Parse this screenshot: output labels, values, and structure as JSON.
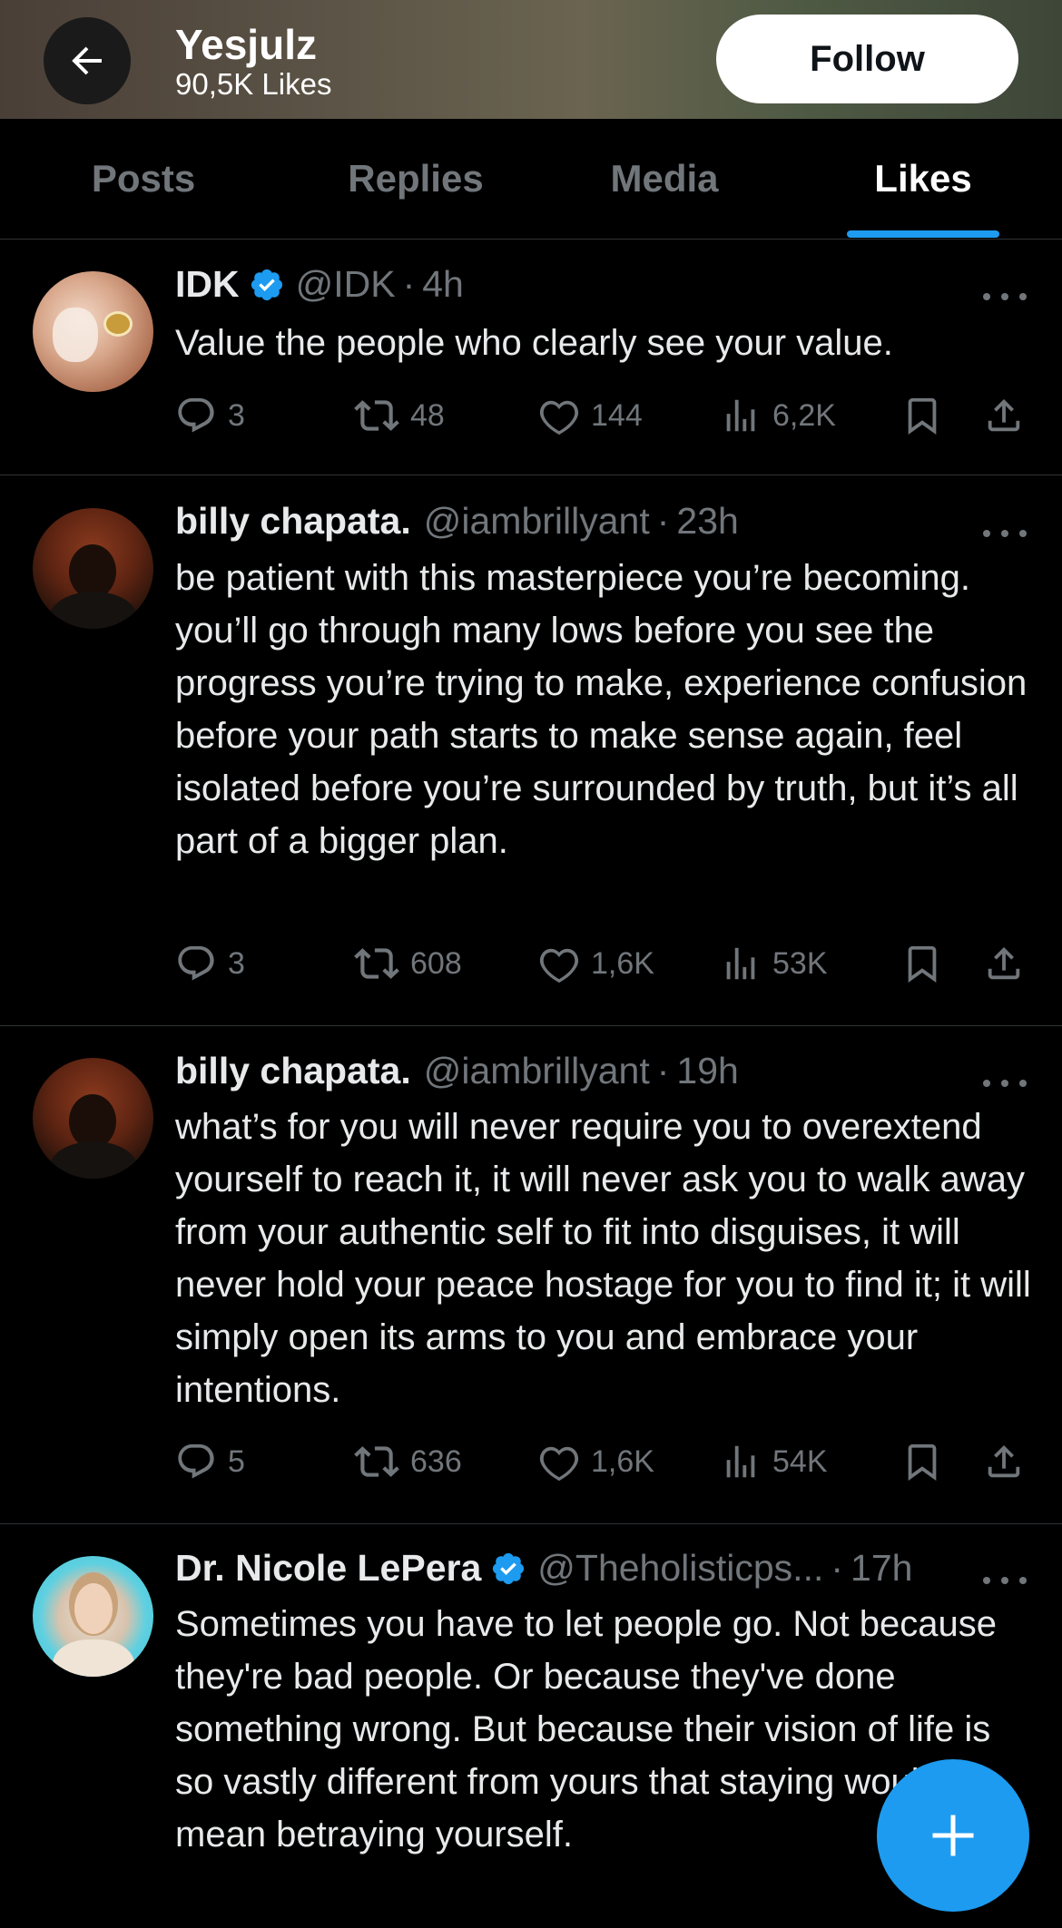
{
  "header": {
    "name": "Yesjulz",
    "likes_count": "90,5K Likes",
    "follow_label": "Follow"
  },
  "tabs": [
    {
      "label": "Posts",
      "active": false
    },
    {
      "label": "Replies",
      "active": false
    },
    {
      "label": "Media",
      "active": false
    },
    {
      "label": "Likes",
      "active": true
    }
  ],
  "tweets": [
    {
      "name": "IDK",
      "verified": true,
      "handle": "@IDK",
      "time": "4h",
      "body": "Value the people who clearly see your value.",
      "replies": "3",
      "reposts": "48",
      "likes": "144",
      "views": "6,2K"
    },
    {
      "name": "billy chapata.",
      "verified": false,
      "handle": "@iambrillyant",
      "time": "23h",
      "body": "be patient with this masterpiece you’re becoming. you’ll go through many lows before you see the progress you’re trying to make, experience confusion before your path starts to make sense again, feel isolated before you’re surrounded by truth, but it’s all part of a bigger plan.",
      "replies": "3",
      "reposts": "608",
      "likes": "1,6K",
      "views": "53K"
    },
    {
      "name": "billy chapata.",
      "verified": false,
      "handle": "@iambrillyant",
      "time": "19h",
      "body": "what’s for you will never require you to overextend yourself to reach it, it will never ask you to walk away from your authentic self to fit into disguises, it will never hold your peace hostage for you to find it; it will simply open its arms to you and embrace your intentions.",
      "replies": "5",
      "reposts": "636",
      "likes": "1,6K",
      "views": "54K"
    },
    {
      "name": "Dr. Nicole LePera",
      "verified": true,
      "handle": "@Theholisticps...",
      "time": "17h",
      "body": "Sometimes you have to let people go. Not because they're bad people. Or because they've done something wrong. But because their vision of life is so vastly different from yours that staying would mean betraying yourself."
    }
  ],
  "separator": "·",
  "colors": {
    "background": "#000000",
    "accent": "#1d9bf0",
    "muted": "#71767b",
    "text": "#e7e9ea"
  },
  "icons": {
    "back": "arrow-left-icon",
    "reply": "reply-bubble-icon",
    "repost": "repost-icon",
    "like": "heart-icon",
    "views": "views-bars-icon",
    "bookmark": "bookmark-icon",
    "share": "share-icon",
    "verified": "verified-badge-icon",
    "more": "more-dots-icon",
    "compose": "plus-icon"
  }
}
